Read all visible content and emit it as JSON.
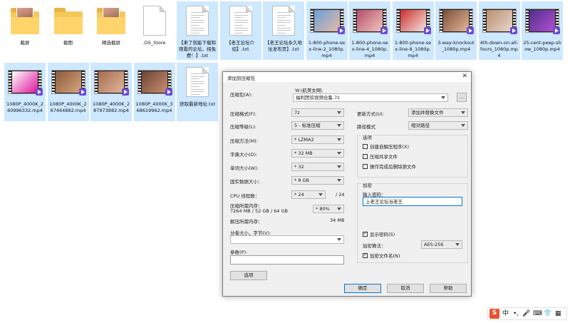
{
  "files": [
    {
      "name": "截屏",
      "type": "folder-image",
      "selected": false
    },
    {
      "name": "截图",
      "type": "folder",
      "selected": false
    },
    {
      "name": "精选截屏",
      "type": "folder-image",
      "selected": false
    },
    {
      "name": ".DS_Store",
      "type": "file",
      "selected": false
    },
    {
      "name": "【来了就能下载和观看的论坛，纯免费！】.txt",
      "type": "text",
      "selected": true
    },
    {
      "name": "【老王论坛介绍】.txt",
      "type": "text",
      "selected": true
    },
    {
      "name": "【老王论坛永久地址发布页】.txt",
      "type": "text",
      "selected": true
    },
    {
      "name": "1-800-phone-sex-line-2_1080p.mp4",
      "type": "video",
      "selected": true
    },
    {
      "name": "1-800-phone-sex-line-4_1080p.mp4",
      "type": "video",
      "selected": true
    },
    {
      "name": "1-800-phone-sex-line-8_1080p.mp4",
      "type": "video",
      "selected": true
    },
    {
      "name": "3-way-knockout_1080p.mp4",
      "type": "video",
      "selected": true
    },
    {
      "name": "4th-down-on-all-fours_1080p.mp4",
      "type": "video",
      "selected": true
    },
    {
      "name": "25-cent-peep-show_1080p.mp4",
      "type": "video",
      "selected": true
    },
    {
      "name": "1080P_4000K_260996332.mp4",
      "type": "video",
      "selected": true
    },
    {
      "name": "1080P_4000K_267464882.mp4",
      "type": "video",
      "selected": true
    },
    {
      "name": "1080P_4000K_287973882.mp4",
      "type": "video",
      "selected": true
    },
    {
      "name": "1080P_4000K_368619962.mp4",
      "type": "video",
      "selected": true
    },
    {
      "name": "获取最新地址.txt",
      "type": "text",
      "selected": true
    }
  ],
  "dialog": {
    "title": "添加到压缩包",
    "close": "✕",
    "archive_label": "压缩包(A):",
    "archive_path": "W:\\航美女网\\",
    "archive_name": "福利团欢视频合集.7z",
    "browse": "...",
    "format_label": "压缩格式(F):",
    "format_value": "7z",
    "level_label": "压缩等级(L):",
    "level_value": "5 - 标准压缩",
    "method_label": "压缩方法(M):",
    "method_value": "* LZMA2",
    "dict_label": "字典大小(D):",
    "dict_value": "* 32 MB",
    "word_label": "单词大小(W):",
    "word_value": "* 32",
    "solid_label": "固实数据大小：",
    "solid_value": "* 8 GB",
    "threads_label": "CPU 线程数：",
    "threads_value": "* 24",
    "threads_total": "/ 24",
    "mem_label": "压缩所需内存：",
    "mem_detail": "7264 MB / 52 GB / 64 GB",
    "mem_percent": "* 80%",
    "decomp_label": "解压所需内存：",
    "decomp_value": "34 MB",
    "split_label": "分卷大小，字节(V):",
    "split_value": "",
    "params_label": "参数(P):",
    "params_value": "",
    "options_btn": "选项",
    "update_label": "更新方式(U):",
    "update_value": "添加并替换文件",
    "path_label": "路径模式",
    "path_value": "相对路径",
    "options_group": "选项",
    "opt_sfx": "创建自解压程序(X)",
    "opt_shared": "压缩共享文件",
    "opt_delete": "操作完成后删除源文件",
    "encrypt_group": "加密",
    "password_label": "输入密码：",
    "password_value": "上老王论坛当老王",
    "show_password": "显示密码(S)",
    "enc_method_label": "加密算法：",
    "enc_method_value": "AES-256",
    "encrypt_names": "加密文件名(N)",
    "ok": "确定",
    "cancel": "取消",
    "help": "帮助"
  },
  "ime": {
    "logo": "S",
    "lang": "中",
    "punct": "•,",
    "mic": "🎤",
    "kb": "⌨",
    "skin": "👕",
    "tools": "▦"
  }
}
